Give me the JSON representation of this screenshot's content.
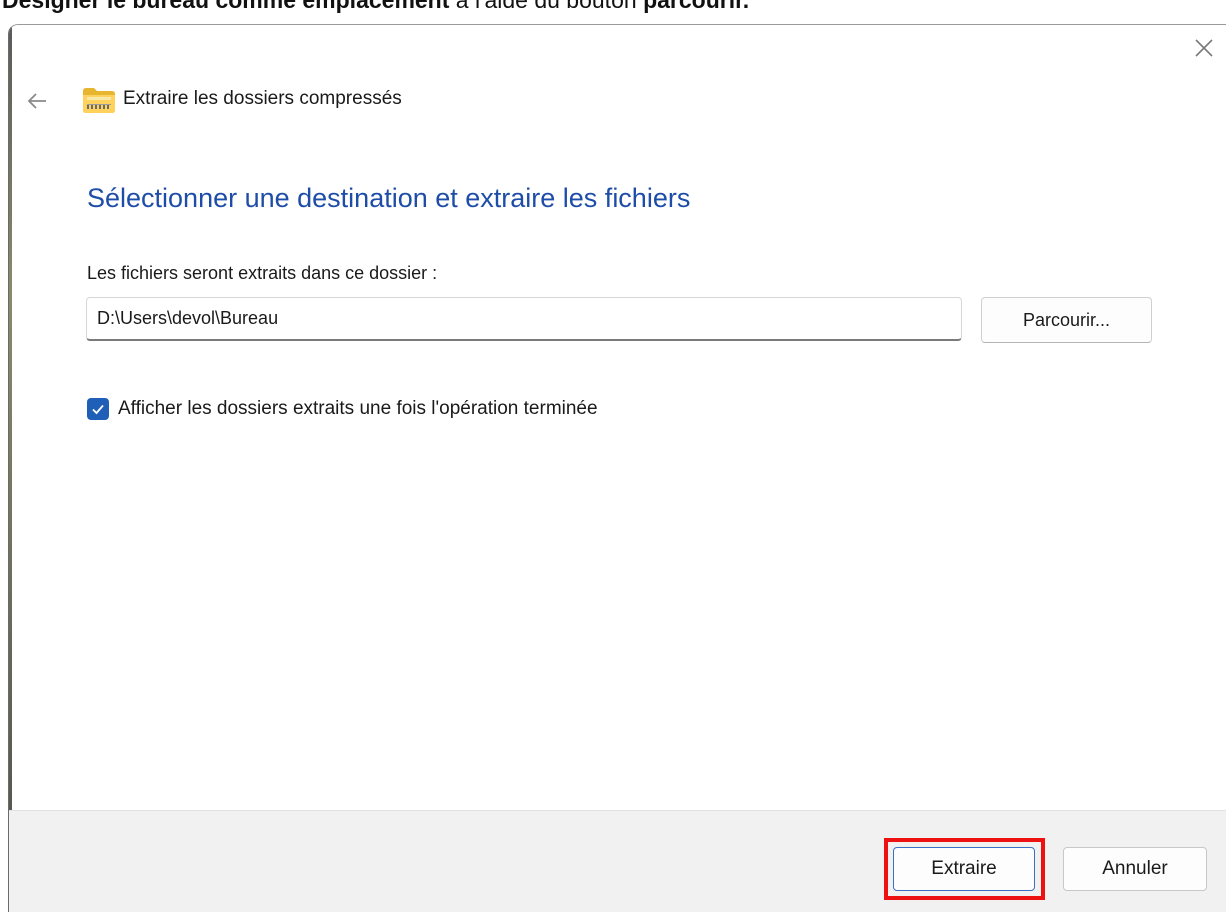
{
  "caption": {
    "part1_bold": "Désigner le bureau comme emplacement",
    "part2": " à l'aide du bouton ",
    "part3_bold": "parcourir."
  },
  "dialog": {
    "wizard_title": "Extraire les dossiers compressés",
    "heading": "Sélectionner une destination et extraire les fichiers",
    "destination_label": "Les fichiers seront extraits dans ce dossier :",
    "destination_value": "D:\\Users\\devol\\Bureau",
    "browse_label": "Parcourir...",
    "checkbox_label": "Afficher les dossiers extraits une fois l'opération terminée",
    "checkbox_checked": true,
    "extract_label": "Extraire",
    "cancel_label": "Annuler"
  },
  "icons": {
    "close": "close-icon",
    "back": "back-arrow-icon",
    "wizard": "zip-folder-icon",
    "check": "checkmark-icon"
  },
  "colors": {
    "heading": "#1e4da8",
    "checkbox": "#1f5fb8",
    "highlight": "#ee1111",
    "footer": "#f1f1f1"
  }
}
